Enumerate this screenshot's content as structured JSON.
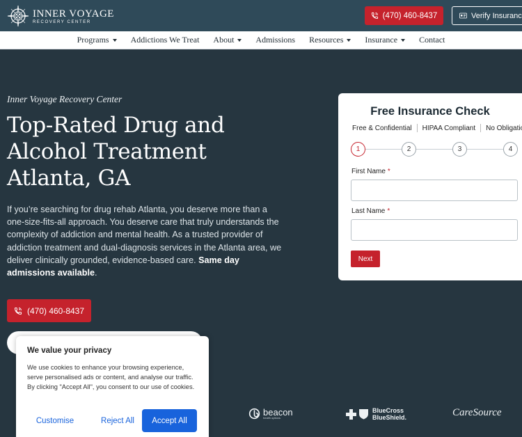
{
  "header": {
    "logo_name": "INNER VOYAGE",
    "logo_sub": "RECOVERY CENTER",
    "phone_label": "(470) 460-8437",
    "verify_label": "Verify Insurance"
  },
  "nav": {
    "items": [
      {
        "label": "Programs",
        "dropdown": true
      },
      {
        "label": "Addictions We Treat",
        "dropdown": false
      },
      {
        "label": "About",
        "dropdown": true
      },
      {
        "label": "Admissions",
        "dropdown": false
      },
      {
        "label": "Resources",
        "dropdown": true
      },
      {
        "label": "Insurance",
        "dropdown": true
      },
      {
        "label": "Contact",
        "dropdown": false
      }
    ]
  },
  "hero": {
    "eyebrow": "Inner Voyage Recovery Center",
    "headline": "Top-Rated Drug and Alcohol Treatment Atlanta, GA",
    "lede": "If you’re searching for drug rehab Atlanta, you deserve more than a one-size-fits-all approach. You deserve care that truly understands the complexity of addiction and mental health. As a trusted provider of addiction treatment and dual-diagnosis services in the Atlanta area, we deliver clinically grounded, evidence-based care.",
    "lede_bold": "Same day admissions available",
    "lede_end": ".",
    "phone_label": "(470) 460-8437"
  },
  "form": {
    "title": "Free Insurance Check",
    "badges": [
      "Free & Confidential",
      "HIPAA Compliant",
      "No Obligation"
    ],
    "steps": [
      "1",
      "2",
      "3",
      "4"
    ],
    "active_step": 1,
    "first_name_label": "First Name",
    "last_name_label": "Last Name",
    "required_mark": "*",
    "first_name_value": "",
    "last_name_value": "",
    "next_label": "Next"
  },
  "logos": {
    "beacon": "beacon",
    "beacon_sub": "health options",
    "bcbs_line1": "BlueCross",
    "bcbs_line2": "BlueShield.",
    "caresource": "CareSource"
  },
  "cookie": {
    "title": "We value your privacy",
    "text": "We use cookies to enhance your browsing experience, serve personalised ads or content, and analyse our traffic. By clicking \"Accept All\", you consent to our use of cookies.",
    "customise_label": "Customise",
    "reject_label": "Reject All",
    "accept_label": "Accept All"
  },
  "colors": {
    "topbar": "#2f4a59",
    "hero_bg": "#263640",
    "accent_red": "#c5222c",
    "cookie_blue": "#1863dc"
  }
}
